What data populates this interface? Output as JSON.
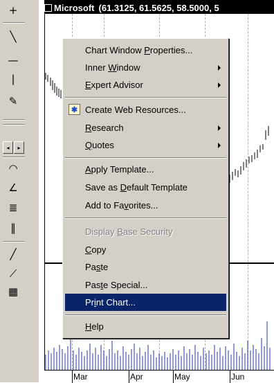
{
  "chart": {
    "title_name": "Microsoft",
    "title_values": "(61.3125, 61.5625, 58.5000, 5"
  },
  "date_axis": {
    "labels": [
      "Mar",
      "Apr",
      "May",
      "Jun"
    ]
  },
  "context_menu": {
    "items": [
      {
        "pre": "Chart Window ",
        "acc": "P",
        "post": "roperties..."
      },
      {
        "pre": "Inner ",
        "acc": "W",
        "post": "indow"
      },
      {
        "pre": "",
        "acc": "E",
        "post": "xpert Advisor"
      },
      {
        "pre": "Create Web Resources...",
        "acc": "",
        "post": ""
      },
      {
        "pre": "",
        "acc": "R",
        "post": "esearch"
      },
      {
        "pre": "",
        "acc": "Q",
        "post": "uotes"
      },
      {
        "pre": "",
        "acc": "A",
        "post": "pply Template..."
      },
      {
        "pre": "Save as ",
        "acc": "D",
        "post": "efault Template"
      },
      {
        "pre": "Add to Fa",
        "acc": "v",
        "post": "orites..."
      },
      {
        "pre": "Display ",
        "acc": "B",
        "post": "ase Security"
      },
      {
        "pre": "",
        "acc": "C",
        "post": "opy"
      },
      {
        "pre": "Pa",
        "acc": "s",
        "post": "te"
      },
      {
        "pre": "Pas",
        "acc": "t",
        "post": "e Special..."
      },
      {
        "pre": "Pr",
        "acc": "i",
        "post": "nt Chart..."
      },
      {
        "pre": "",
        "acc": "H",
        "post": "elp"
      }
    ]
  },
  "toolbar": {
    "icons": [
      "crosshair-icon",
      "trendline-icon",
      "horizontal-line-icon",
      "vertical-line-icon",
      "text-annotation-icon",
      "scroll-left-icon",
      "scroll-right-icon",
      "arc-icon",
      "fan-icon",
      "fibonacci-retracement-icon",
      "time-zones-icon",
      "line-icon",
      "speed-lines-icon",
      "gann-grid-icon"
    ],
    "glyphs": [
      "+",
      "╲",
      "—",
      "|",
      "✎",
      "◂",
      "▸",
      "◠",
      "∠",
      "≣",
      "‖",
      "╱",
      "⟋",
      "▦"
    ]
  }
}
